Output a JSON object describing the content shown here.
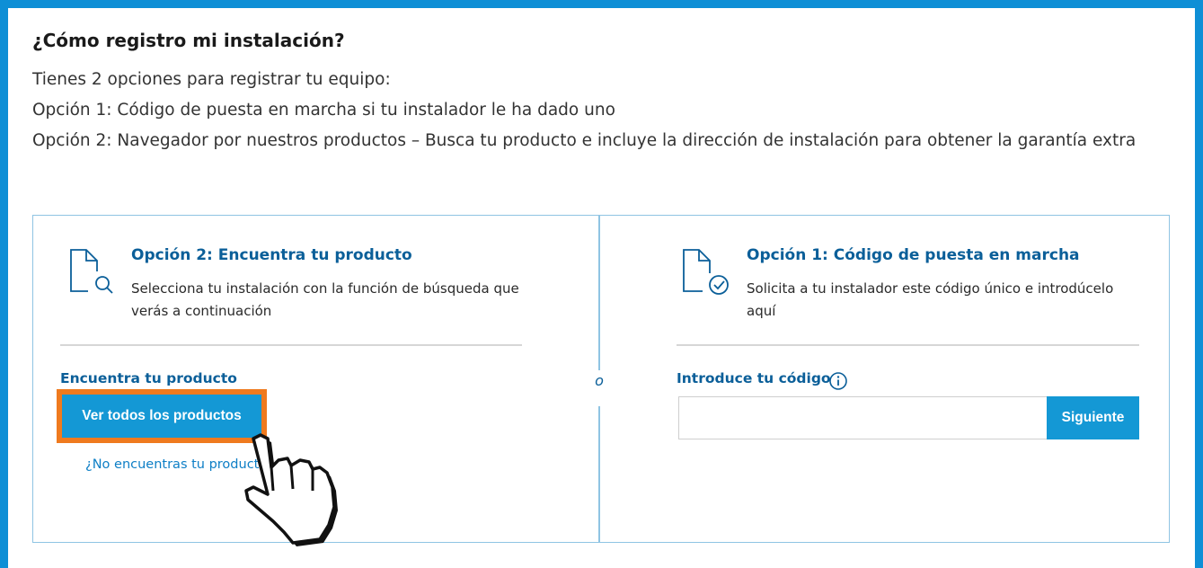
{
  "heading": "¿Cómo registro mi instalación?",
  "intro": {
    "line1": "Tienes 2 opciones para registrar tu equipo:",
    "line2": "Opción 1: Código de puesta en marcha si tu instalador le ha dado uno",
    "line3": "Opción 2: Navegador por nuestros productos – Busca tu producto e incluye la dirección de instalación para obtener la garantía extra"
  },
  "left": {
    "title": "Opción 2: Encuentra tu producto",
    "description": "Selecciona tu instalación con la función de búsqueda que verás a continuación",
    "section_label": "Encuentra tu producto",
    "button_label": "Ver todos los productos",
    "link_label": "¿No encuentras tu producto?",
    "icon": "document-search-icon"
  },
  "divider_label": "o",
  "right": {
    "title": "Opción 1: Código de puesta en marcha",
    "description": "Solicita a tu instalador este código único e introdúcelo aquí",
    "input_label": "Introduce tu código",
    "input_value": "",
    "button_label": "Siguiente",
    "icon": "document-check-icon"
  },
  "colors": {
    "frame": "#0e8fd6",
    "accent": "#0b5f99",
    "button": "#1498d5",
    "highlight": "#ef7a1e"
  }
}
